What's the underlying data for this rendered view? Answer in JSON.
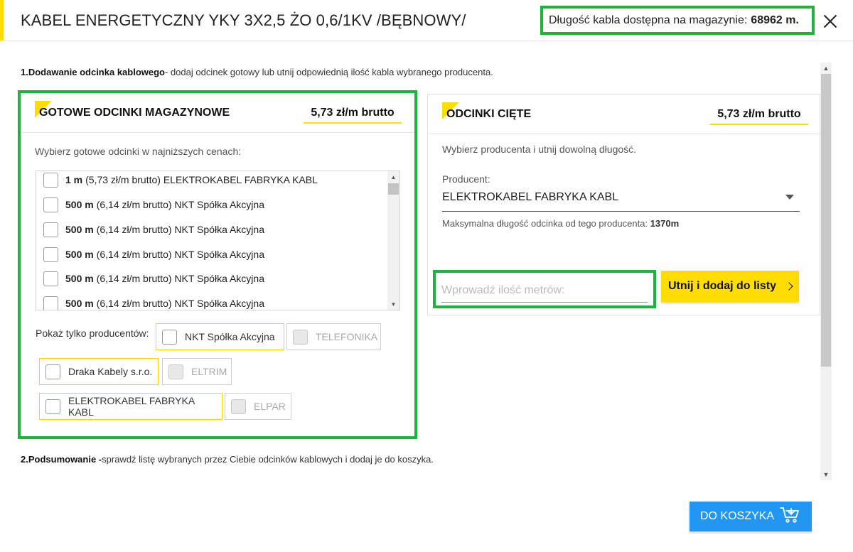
{
  "header": {
    "title": "KABEL ENERGETYCZNY YKY 3X2,5 ŻO 0,6/1KV /BĘBNOWY/",
    "stock_label": "Długość kabla dostępna na magazynie:",
    "stock_value": "68962 m.",
    "close_icon": "close-icon"
  },
  "section1": {
    "bold": "1.Dodawanie odcinka kablowego",
    "text": "- dodaj odcinek gotowy lub utnij odpowiednią ilość kabla wybranego producenta."
  },
  "ready_segments": {
    "title": "GOTOWE ODCINKI MAGAZYNOWE",
    "price": "5,73 zł/m brutto",
    "hint": "Wybierz gotowe odcinki w najniższych cenach:",
    "items": [
      {
        "length": "1 m",
        "desc": "(5,73 zł/m brutto) ELEKTROKABEL FABRYKA KABL"
      },
      {
        "length": "500 m",
        "desc": "(6,14 zł/m brutto) NKT Spółka Akcyjna"
      },
      {
        "length": "500 m",
        "desc": "(6,14 zł/m brutto) NKT Spółka Akcyjna"
      },
      {
        "length": "500 m",
        "desc": "(6,14 zł/m brutto) NKT Spółka Akcyjna"
      },
      {
        "length": "500 m",
        "desc": "(6,14 zł/m brutto) NKT Spółka Akcyjna"
      },
      {
        "length": "500 m",
        "desc": "(6,14 zł/m brutto) NKT Spółka Akcyjna"
      }
    ],
    "filter_label": "Pokaż tylko producentów:",
    "producers": [
      {
        "name": "NKT Spółka Akcyjna",
        "enabled": true
      },
      {
        "name": "TELEFONIKA",
        "enabled": false
      },
      {
        "name": "Draka Kabely s.r.o.",
        "enabled": true
      },
      {
        "name": "ELTRIM",
        "enabled": false
      },
      {
        "name": "ELEKTROKABEL FABRYKA KABL",
        "enabled": true
      },
      {
        "name": "ELPAR",
        "enabled": false
      }
    ]
  },
  "cut_segments": {
    "title": "ODCINKI CIĘTE",
    "price": "5,73 zł/m brutto",
    "hint": "Wybierz producenta i utnij dowolną długość.",
    "producer_label": "Producent:",
    "producer_value": "ELEKTROKABEL FABRYKA KABL",
    "max_label": "Maksymalna długość odcinka od tego producenta:",
    "max_value": "1370m",
    "input_placeholder": "Wprowadź ilość metrów:",
    "cut_button": "Utnij i dodaj do listy"
  },
  "section2": {
    "bold": "2.Podsumowanie -",
    "text": "sprawdź listę wybranych przez Ciebie odcinków kablowych i dodaj je do koszyka."
  },
  "footer": {
    "cart_button": "DO KOSZYKA",
    "cart_icon": "cart-icon"
  },
  "colors": {
    "accent_yellow": "#ffdd00",
    "highlight_green": "#1db43c",
    "primary_blue": "#2196f3"
  }
}
